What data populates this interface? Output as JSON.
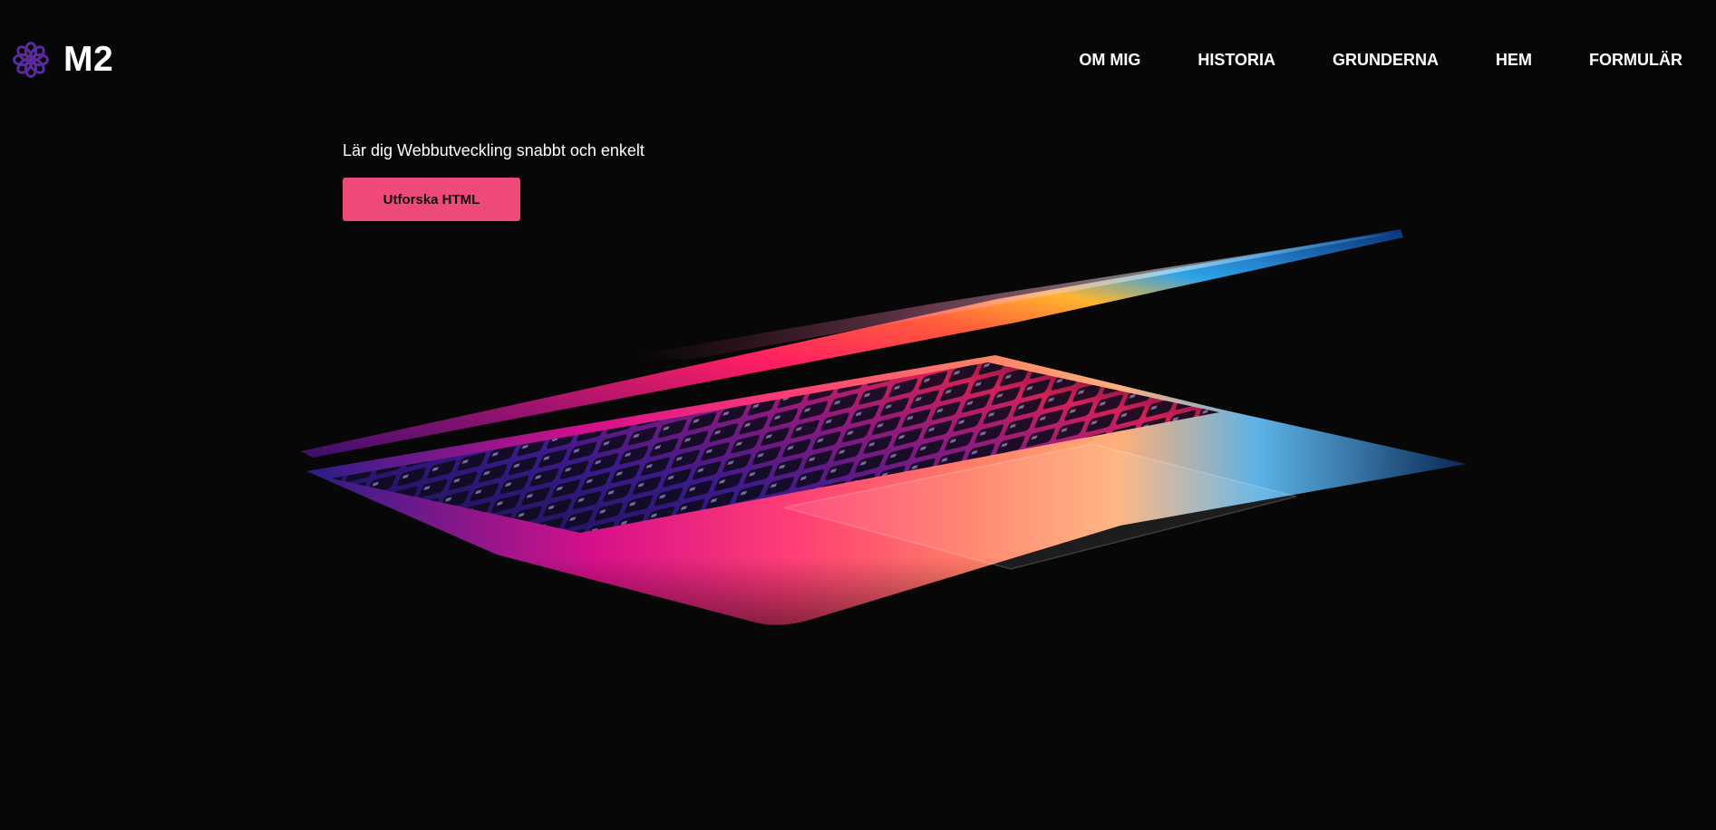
{
  "brand": {
    "name": "M2",
    "icon": "flower-icon",
    "icon_color": "#5b2a9c"
  },
  "nav": {
    "items": [
      {
        "label": "OM MIG"
      },
      {
        "label": "HISTORIA"
      },
      {
        "label": "GRUNDERNA"
      },
      {
        "label": "HEM"
      },
      {
        "label": "FORMULÄR"
      }
    ]
  },
  "hero": {
    "tagline": "Lär dig Webbutveckling snabbt och enkelt",
    "cta_label": "Utforska HTML",
    "cta_color": "#ee4a79",
    "image": "laptop-illustration"
  },
  "colors": {
    "background": "#070707",
    "text": "#ffffff"
  }
}
